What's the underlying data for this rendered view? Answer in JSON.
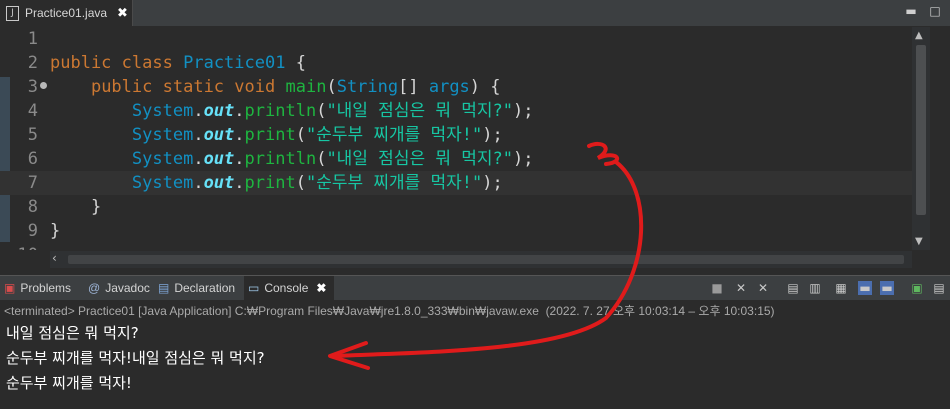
{
  "editor_tab": {
    "title": "Practice01.java",
    "close": "✖"
  },
  "window_buttons": {
    "minimize": "▬",
    "maximize": "□"
  },
  "code_lines": [
    {
      "n": "1"
    },
    {
      "n": "2"
    },
    {
      "n": "3"
    },
    {
      "n": "4"
    },
    {
      "n": "5"
    },
    {
      "n": "6"
    },
    {
      "n": "7"
    },
    {
      "n": "8"
    },
    {
      "n": "9"
    },
    {
      "n": "10"
    }
  ],
  "code": {
    "l2_kw1": "public",
    "l2_kw2": "class",
    "l2_name": "Practice01",
    "l2_rest": " {",
    "l3_kw1": "public",
    "l3_kw2": "static",
    "l3_kw3": "void",
    "l3_m": "main",
    "l3_t": "String",
    "l3_p": "args",
    "l3_rest": ") {",
    "sys": "System",
    "out": "out",
    "l4_m": "println",
    "l4_s": "\"내일 점심은 뭐 먹지?\"",
    "l5_m": "print",
    "l5_s": "\"순두부 찌개를 먹자!\"",
    "l6_m": "println",
    "l6_s": "\"내일 점심은 뭐 먹지?\"",
    "l7_m": "print",
    "l7_s": "\"순두부 찌개를 먹자!\"",
    "l8": "}",
    "l9": "}"
  },
  "views": {
    "problems": "Problems",
    "javadoc": "Javadoc",
    "declaration": "Declaration",
    "console": "Console",
    "close": "✖"
  },
  "console": {
    "terminated": "<terminated> Practice01 [Java Application] C:₩Program Files₩Java₩jre1.8.0_333₩bin₩javaw.exe  (2022. 7. 27 오후 10:03:14 – 오후 10:03:15)",
    "lines": [
      "내일 점심은 뭐 먹지?",
      "순두부 찌개를 먹자!내일 점심은 뭐 먹지?",
      "순두부 찌개를 먹자!"
    ]
  },
  "colors": {
    "annotation": "#e01b1b"
  }
}
